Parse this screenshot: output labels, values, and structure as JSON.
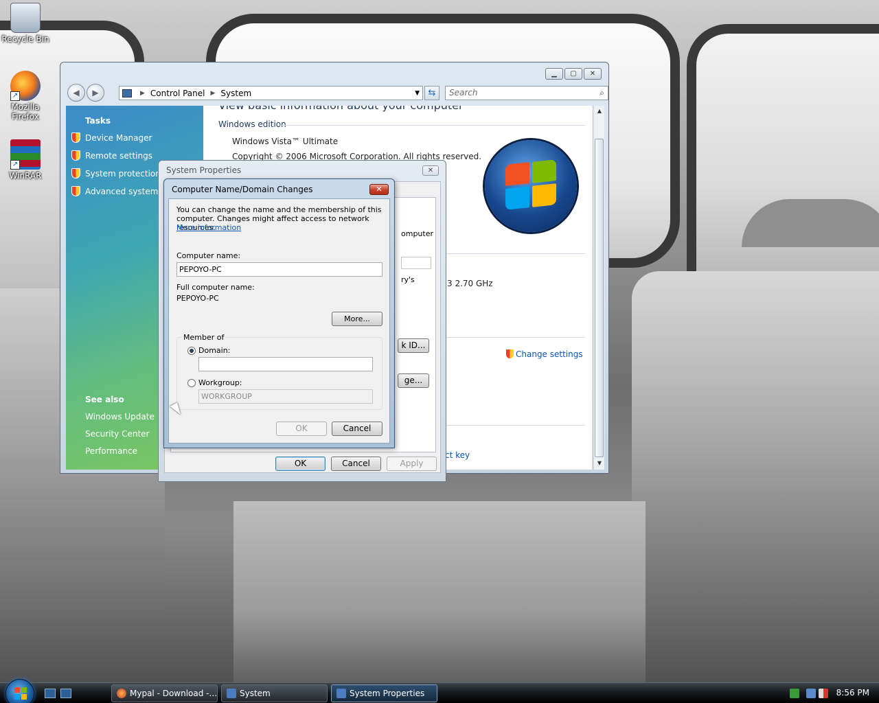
{
  "desktop": {
    "icons": [
      {
        "label": "Recycle Bin",
        "icon": "recycle-bin-icon"
      },
      {
        "label": "Mozilla Firefox",
        "icon": "firefox-icon"
      },
      {
        "label": "WinRAR",
        "icon": "winrar-icon"
      }
    ]
  },
  "explorer": {
    "breadcrumb": [
      "Control Panel",
      "System"
    ],
    "search_placeholder": "Search",
    "tasks_header": "Tasks",
    "tasks": [
      "Device Manager",
      "Remote settings",
      "System protection",
      "Advanced system se"
    ],
    "see_also_header": "See also",
    "see_also": [
      "Windows Update",
      "Security Center",
      "Performance"
    ],
    "content": {
      "heading": "View basic information about your computer",
      "section_edition": "Windows edition",
      "edition": "Windows Vista™ Ultimate",
      "copyright": "Copyright © 2006 Microsoft Corporation.  All rights reserved.",
      "cpu_speed": "3  2.70 GHz",
      "change_settings": "Change settings",
      "product_key_fragment": "ct key"
    }
  },
  "system_properties": {
    "title": "System Properties",
    "ok": "OK",
    "cancel": "Cancel",
    "apply": "Apply",
    "behind_text": {
      "computer": "omputer",
      "ys": "ry's",
      "id_button": "k ID...",
      "change_button": "ge..."
    }
  },
  "computer_name_dialog": {
    "title": "Computer Name/Domain Changes",
    "description": "You can change the name and the membership of this computer. Changes might affect access to network resources.",
    "more_info_link": "More information",
    "computer_name_label": "Computer name:",
    "computer_name_value": "PEPOYO-PC",
    "full_name_label": "Full computer name:",
    "full_name_value": "PEPOYO-PC",
    "more_button": "More...",
    "member_of_label": "Member of",
    "domain_label": "Domain:",
    "domain_value": "",
    "workgroup_label": "Workgroup:",
    "workgroup_value": "WORKGROUP",
    "ok": "OK",
    "cancel": "Cancel"
  },
  "taskbar": {
    "buttons": [
      "Mypal - Download -...",
      "System",
      "System Properties"
    ],
    "clock": "8:56 PM"
  }
}
